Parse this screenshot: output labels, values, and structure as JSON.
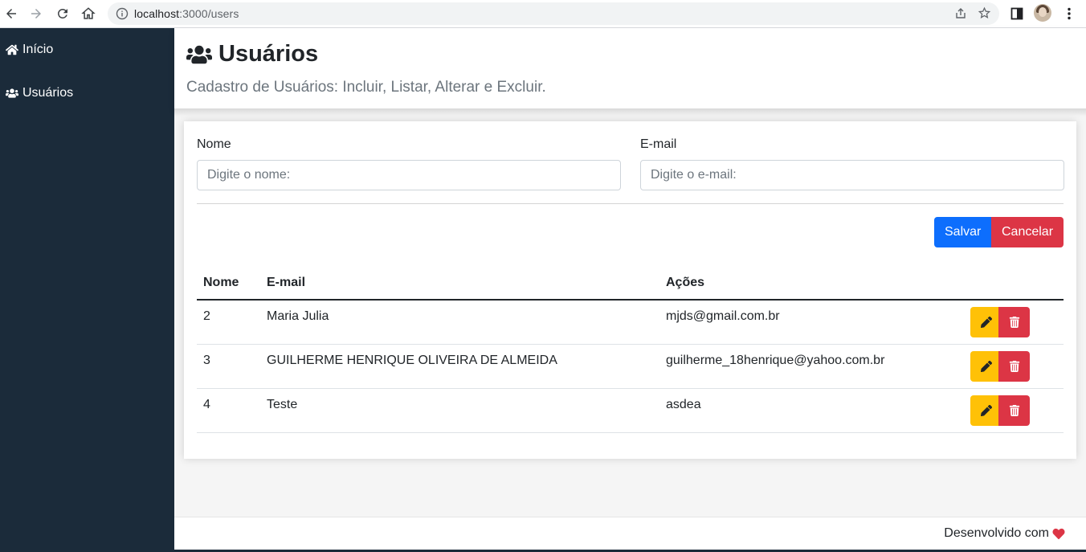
{
  "browser": {
    "url_host": "localhost",
    "url_rest": ":3000/users"
  },
  "sidebar": {
    "items": [
      {
        "label": "Início",
        "icon": "home-icon"
      },
      {
        "label": "Usuários",
        "icon": "users-icon"
      }
    ]
  },
  "header": {
    "title": "Usuários",
    "subtitle": "Cadastro de Usuários: Incluir, Listar, Alterar e Excluir."
  },
  "form": {
    "name_label": "Nome",
    "name_placeholder": "Digite o nome:",
    "name_value": "",
    "email_label": "E-mail",
    "email_placeholder": "Digite o e-mail:",
    "email_value": "",
    "save_label": "Salvar",
    "cancel_label": "Cancelar"
  },
  "table": {
    "headers": [
      "Nome",
      "E-mail",
      "Ações",
      ""
    ],
    "rows": [
      {
        "id": "2",
        "name": "Maria Julia",
        "email": "mjds@gmail.com.br"
      },
      {
        "id": "3",
        "name": "GUILHERME HENRIQUE OLIVEIRA DE ALMEIDA",
        "email": "guilherme_18henrique@yahoo.com.br"
      },
      {
        "id": "4",
        "name": "Teste",
        "email": "asdea"
      }
    ]
  },
  "footer": {
    "text": "Desenvolvido com"
  },
  "colors": {
    "sidebar": "#1b2b3a",
    "primary": "#0d6efd",
    "danger": "#dc3545",
    "warning": "#ffc107",
    "heart": "#dc3545"
  }
}
